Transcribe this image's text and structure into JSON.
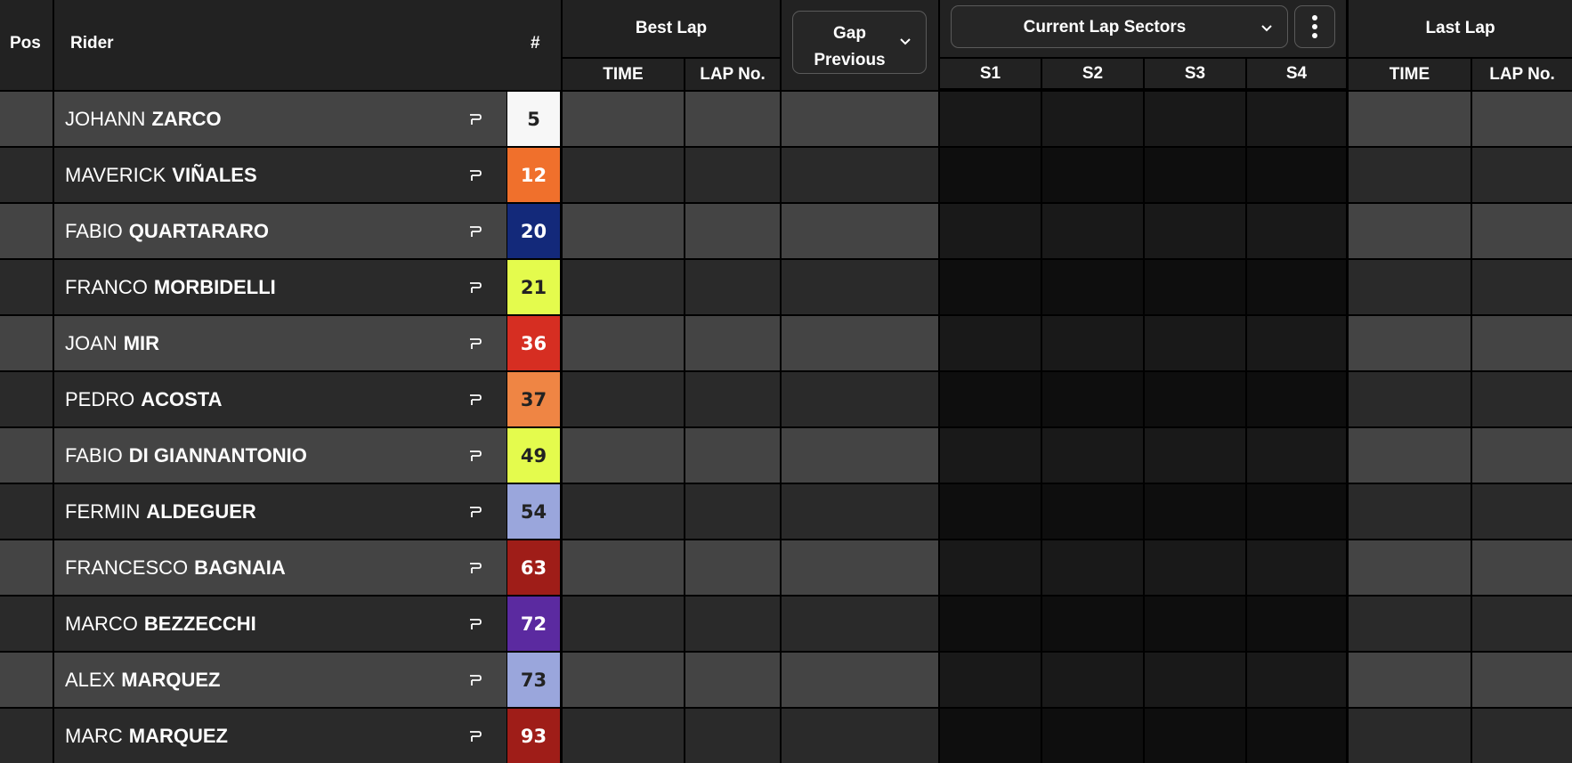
{
  "header": {
    "pos": "Pos",
    "rider": "Rider",
    "number": "#",
    "best_lap": "Best Lap",
    "best_time": "TIME",
    "best_lap_no": "LAP No.",
    "gap_line1": "Gap",
    "gap_line2": "Previous",
    "sectors_dropdown": "Current Lap Sectors",
    "s1": "S1",
    "s2": "S2",
    "s3": "S3",
    "s4": "S4",
    "last_lap": "Last Lap",
    "last_time": "TIME",
    "last_lap_no": "LAP No."
  },
  "riders": [
    {
      "first": "JOHANN",
      "last": "ZARCO",
      "number": "5",
      "bg": "#f7f7f7",
      "fg": "#222222"
    },
    {
      "first": "MAVERICK",
      "last": "VIÑALES",
      "number": "12",
      "bg": "#f0702c",
      "fg": "#ffffff"
    },
    {
      "first": "FABIO",
      "last": "QUARTARARO",
      "number": "20",
      "bg": "#13297a",
      "fg": "#ffffff"
    },
    {
      "first": "FRANCO",
      "last": "MORBIDELLI",
      "number": "21",
      "bg": "#e4fb4d",
      "fg": "#222222"
    },
    {
      "first": "JOAN",
      "last": "MIR",
      "number": "36",
      "bg": "#d62e22",
      "fg": "#ffffff"
    },
    {
      "first": "PEDRO",
      "last": "ACOSTA",
      "number": "37",
      "bg": "#ef8544",
      "fg": "#222222"
    },
    {
      "first": "FABIO",
      "last": "DI GIANNANTONIO",
      "number": "49",
      "bg": "#e4fb4d",
      "fg": "#222222"
    },
    {
      "first": "FERMIN",
      "last": "ALDEGUER",
      "number": "54",
      "bg": "#9aa6dc",
      "fg": "#222222"
    },
    {
      "first": "FRANCESCO",
      "last": "BAGNAIA",
      "number": "63",
      "bg": "#9f1d18",
      "fg": "#ffffff"
    },
    {
      "first": "MARCO",
      "last": "BEZZECCHI",
      "number": "72",
      "bg": "#5b2aa0",
      "fg": "#ffffff"
    },
    {
      "first": "ALEX",
      "last": "MARQUEZ",
      "number": "73",
      "bg": "#9aa6dc",
      "fg": "#222222"
    },
    {
      "first": "MARC",
      "last": "MARQUEZ",
      "number": "93",
      "bg": "#9f1d18",
      "fg": "#ffffff"
    }
  ],
  "icons": {
    "rider_icon": "p-marker-icon",
    "dropdown": "chevron-down-icon",
    "menu": "kebab-menu-icon"
  },
  "colors": {
    "header_bg": "#222222",
    "row_light": "#444444",
    "row_dark": "#2a2a2a",
    "sector_light": "#191919",
    "sector_dark": "#0e0e0e"
  }
}
